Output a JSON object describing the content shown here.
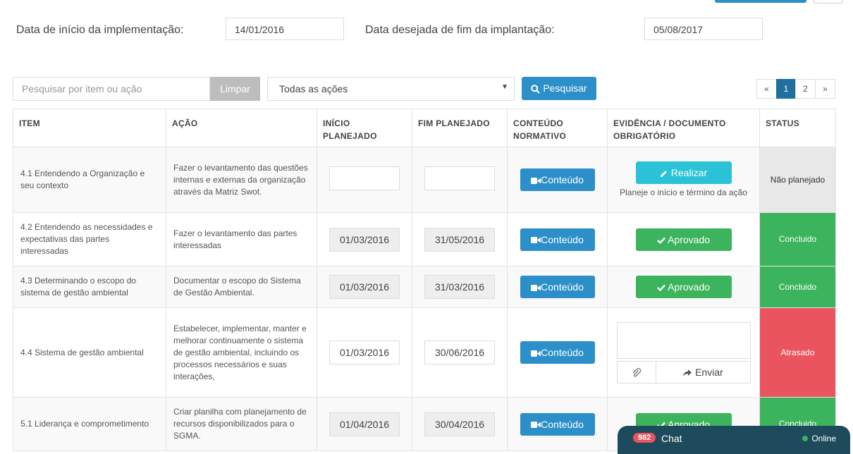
{
  "header": {
    "start_label": "Data de início da implementação:",
    "start_value": "14/01/2016",
    "end_label": "Data desejada de fim da implantação:",
    "end_value": "05/08/2017"
  },
  "toolbar": {
    "search_placeholder": "Pesquisar por item ou ação",
    "clear_label": "Limpar",
    "filter_selected": "Todas as ações",
    "search_button": "Pesquisar"
  },
  "pagination": {
    "prev": "«",
    "pages": [
      "1",
      "2"
    ],
    "next": "»",
    "active": "1"
  },
  "columns": [
    "ITEM",
    "AÇÃO",
    "INÍCIO PLANEJADO",
    "FIM PLANEJADO",
    "CONTEÚDO NORMATIVO",
    "EVIDÊNCIA / DOCUMENTO OBRIGATÓRIO",
    "STATUS"
  ],
  "rows": [
    {
      "item": "4.1 Entendendo a Organização e seu contexto",
      "acao": "Fazer o levantamento das questões internas e externas da organização através da Matriz Swot.",
      "inicio": "",
      "fim": "",
      "conteudo": "Conteúdo",
      "evidencia_button": "Realizar",
      "evidencia_hint": "Planeje o início e término da ação",
      "status": "Não planejado"
    },
    {
      "item": "4.2 Entendendo as necessidades e expectativas das partes interessadas",
      "acao": "Fazer o levantamento das partes interessadas",
      "inicio": "01/03/2016",
      "fim": "31/05/2016",
      "conteudo": "Conteúdo",
      "evidencia_button": "Aprovado",
      "status": "Concluido"
    },
    {
      "item": "4.3 Determinando o escopo do sistema de gestão ambiental",
      "acao": "Documentar o escopo do Sistema de Gestão Ambiental.",
      "inicio": "01/03/2016",
      "fim": "31/03/2016",
      "conteudo": "Conteúdo",
      "evidencia_button": "Aprovado",
      "status": "Concluido"
    },
    {
      "item": "4.4 Sistema de gestão ambiental",
      "acao": "Estabelecer, implementar, manter e melhorar continuamente o sistema de gestão ambiental, incluindo os processos necessários e suas interações,",
      "inicio": "01/03/2016",
      "fim": "30/06/2016",
      "conteudo": "Conteúdo",
      "evidencia_send": "Enviar",
      "status": "Atrasado"
    },
    {
      "item": "5.1 Liderança e comprometimento",
      "acao": "Criar planilha com planejamento de recursos disponibilizados para o SGMA.",
      "inicio": "01/04/2016",
      "fim": "30/04/2016",
      "conteudo": "Conteúdo",
      "evidencia_button": "Aprovado",
      "status": "Concluido"
    }
  ],
  "chat": {
    "badge": "982",
    "title": "Chat",
    "status": "Online"
  },
  "colors": {
    "primary": "#2c8fc9",
    "info": "#2bc1d6",
    "success": "#3cb35d",
    "danger": "#e9545e",
    "chat": "#1e4b5b"
  }
}
